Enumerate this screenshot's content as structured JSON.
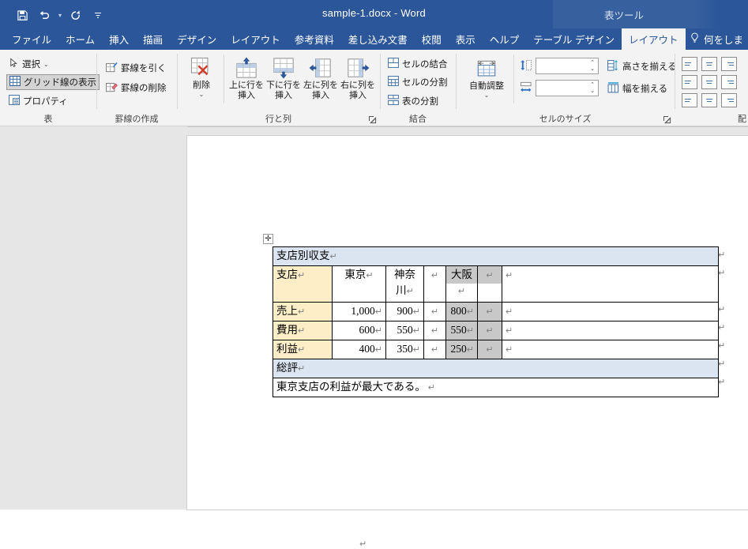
{
  "window": {
    "document_title": "sample-1.docx  -  Word",
    "contextual_title": "表ツール",
    "quick_access": [
      {
        "name": "save",
        "icon": "save-icon"
      },
      {
        "name": "undo",
        "icon": "undo-icon"
      },
      {
        "name": "redo",
        "icon": "redo-icon"
      },
      {
        "name": "customize-qat",
        "icon": "chevron-down-icon"
      }
    ]
  },
  "tabs": [
    {
      "label": "ファイル",
      "active": false,
      "contextual": false
    },
    {
      "label": "ホーム",
      "active": false,
      "contextual": false
    },
    {
      "label": "挿入",
      "active": false,
      "contextual": false
    },
    {
      "label": "描画",
      "active": false,
      "contextual": false
    },
    {
      "label": "デザイン",
      "active": false,
      "contextual": false
    },
    {
      "label": "レイアウト",
      "active": false,
      "contextual": false
    },
    {
      "label": "参考資料",
      "active": false,
      "contextual": false
    },
    {
      "label": "差し込み文書",
      "active": false,
      "contextual": false
    },
    {
      "label": "校閲",
      "active": false,
      "contextual": false
    },
    {
      "label": "表示",
      "active": false,
      "contextual": false
    },
    {
      "label": "ヘルプ",
      "active": false,
      "contextual": false
    },
    {
      "label": "テーブル デザイン",
      "active": false,
      "contextual": true
    },
    {
      "label": "レイアウト",
      "active": true,
      "contextual": true
    }
  ],
  "tell_me": {
    "label": "何をしま",
    "icon": "lightbulb-icon"
  },
  "ribbon": {
    "groups": [
      {
        "name": "table",
        "label": "表",
        "items": [
          {
            "label": "選択",
            "icon": "pointer-icon",
            "has_dropdown": true,
            "toggled": false
          },
          {
            "label": "グリッド線の表示",
            "icon": "grid-icon",
            "has_dropdown": false,
            "toggled": true
          },
          {
            "label": "プロパティ",
            "icon": "properties-icon",
            "has_dropdown": false,
            "toggled": false
          }
        ]
      },
      {
        "name": "draw-borders",
        "label": "罫線の作成",
        "items": [
          {
            "label": "罫線を引く",
            "icon": "draw-table-icon",
            "has_dropdown": false,
            "toggled": false
          },
          {
            "label": "罫線の削除",
            "icon": "eraser-icon",
            "has_dropdown": false,
            "toggled": false
          }
        ]
      },
      {
        "name": "rows-and-columns",
        "label": "行と列",
        "has_dialog_launcher": true,
        "items": [
          {
            "label": "削除",
            "icon": "delete-table-icon",
            "has_dropdown": true
          },
          {
            "label": "上に行を\n挿入",
            "icon": "insert-above-icon",
            "has_dropdown": false
          },
          {
            "label": "下に行を\n挿入",
            "icon": "insert-below-icon",
            "has_dropdown": false
          },
          {
            "label": "左に列を\n挿入",
            "icon": "insert-left-icon",
            "has_dropdown": false
          },
          {
            "label": "右に列を\n挿入",
            "icon": "insert-right-icon",
            "has_dropdown": false
          }
        ]
      },
      {
        "name": "merge",
        "label": "結合",
        "items": [
          {
            "label": "セルの結合",
            "icon": "merge-cells-icon"
          },
          {
            "label": "セルの分割",
            "icon": "split-cells-icon"
          },
          {
            "label": "表の分割",
            "icon": "split-table-icon"
          }
        ]
      },
      {
        "name": "cell-size",
        "label": "セルのサイズ",
        "has_dialog_launcher": true,
        "items": [
          {
            "label": "自動調整",
            "icon": "autofit-icon",
            "has_dropdown": true
          },
          {
            "label": "高さを揃える",
            "icon": "distribute-rows-icon"
          },
          {
            "label": "幅を揃える",
            "icon": "distribute-columns-icon"
          }
        ],
        "fields": [
          {
            "name": "row-height",
            "icon": "row-height-icon",
            "value": "",
            "placeholder": ""
          },
          {
            "name": "column-width",
            "icon": "column-width-icon",
            "value": "",
            "placeholder": ""
          }
        ]
      },
      {
        "name": "alignment",
        "label": "配",
        "items": [
          {
            "label": "上揃え(左)",
            "icon": "align-top-left-icon"
          },
          {
            "label": "上揃え(中央)",
            "icon": "align-top-center-icon"
          },
          {
            "label": "上揃え(右)",
            "icon": "align-top-right-icon"
          },
          {
            "label": "中央揃え(左)",
            "icon": "align-middle-left-icon"
          },
          {
            "label": "中央揃え(中央)",
            "icon": "align-middle-center-icon"
          },
          {
            "label": "中央揃え(右)",
            "icon": "align-middle-right-icon"
          },
          {
            "label": "下揃え(左)",
            "icon": "align-bottom-left-icon"
          },
          {
            "label": "下揃え(中央)",
            "icon": "align-bottom-center-icon"
          },
          {
            "label": "下揃え(右)",
            "icon": "align-bottom-right-icon"
          }
        ]
      }
    ]
  },
  "document": {
    "paragraph_mark": "↵",
    "table": {
      "caption_row": {
        "text": "支店別収支",
        "style": "header-band"
      },
      "header_row": {
        "label": "支店",
        "cells": [
          "東京",
          "神奈川",
          "",
          "大阪",
          "",
          ""
        ]
      },
      "data_rows": [
        {
          "label": "売上",
          "cells": [
            "1,000",
            "900",
            "",
            "800",
            "",
            ""
          ]
        },
        {
          "label": "費用",
          "cells": [
            "600",
            "550",
            "",
            "550",
            "",
            ""
          ]
        },
        {
          "label": "利益",
          "cells": [
            "400",
            "350",
            "",
            "250",
            "",
            ""
          ]
        }
      ],
      "summary_label_row": {
        "text": "総評",
        "style": "header-band"
      },
      "summary_text_row": {
        "text": "東京支店の利益が最大である。"
      }
    },
    "trailing_paragraph": "↵"
  },
  "colors": {
    "brand": "#2b579a",
    "contextual_band": "#37609f",
    "ribbon_bg": "#f3f3f3",
    "page_bg": "#e6e6e6",
    "band_fill": "#dbe5f1",
    "label_fill": "#fdeec8",
    "selection_fill": "#c8c8c8",
    "icon_blue": "#4472a8"
  }
}
